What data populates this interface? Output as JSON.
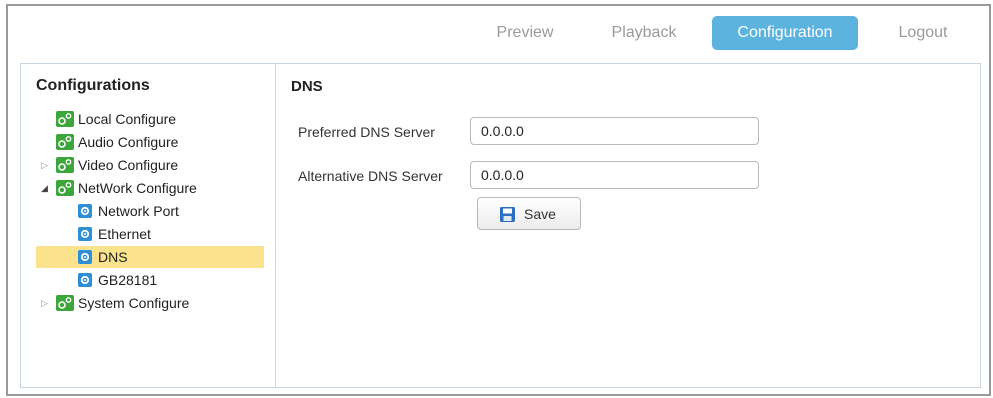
{
  "nav": {
    "items": [
      {
        "label": "Preview"
      },
      {
        "label": "Playback"
      },
      {
        "label": "Configuration"
      },
      {
        "label": "Logout"
      }
    ],
    "active": "Configuration"
  },
  "sidebar": {
    "title": "Configurations",
    "items": [
      {
        "label": "Local Configure",
        "icon": "gear-cluster-icon",
        "expandable": false
      },
      {
        "label": "Audio Configure",
        "icon": "gear-cluster-icon",
        "expandable": false
      },
      {
        "label": "Video Configure",
        "icon": "gear-cluster-icon",
        "expandable": true,
        "expanded": false
      },
      {
        "label": "NetWork Configure",
        "icon": "gear-cluster-icon",
        "expandable": true,
        "expanded": true,
        "children": [
          {
            "label": "Network Port",
            "icon": "gear-icon"
          },
          {
            "label": "Ethernet",
            "icon": "gear-icon"
          },
          {
            "label": "DNS",
            "icon": "gear-icon",
            "selected": true
          },
          {
            "label": "GB28181",
            "icon": "gear-icon"
          }
        ]
      },
      {
        "label": "System Configure",
        "icon": "gear-cluster-icon",
        "expandable": true,
        "expanded": false
      }
    ]
  },
  "content": {
    "title": "DNS",
    "preferred": {
      "label": "Preferred DNS Server",
      "value": "0.0.0.0"
    },
    "alternative": {
      "label": "Alternative DNS Server",
      "value": "0.0.0.0"
    },
    "save_label": "Save"
  },
  "colors": {
    "accent": "#5cb3de",
    "selected_row": "#fbe28c",
    "icon_green": "#3da63b",
    "icon_blue": "#2e8fd6",
    "border": "#c8d6e2"
  }
}
